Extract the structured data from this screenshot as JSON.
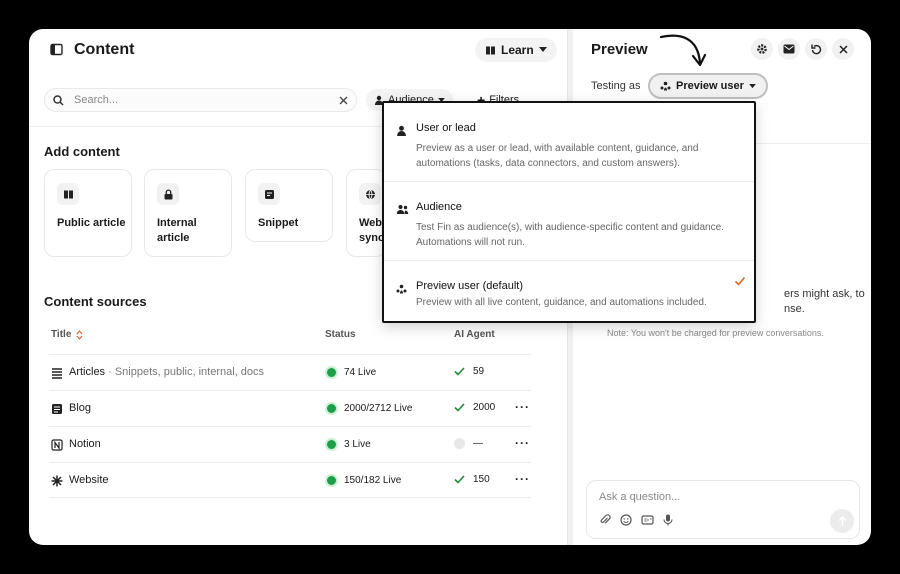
{
  "content_panel": {
    "title": "Content",
    "learn_label": "Learn",
    "search_placeholder": "Search...",
    "audience_label": "Audience",
    "filters_label": "Filters",
    "add_content_title": "Add content",
    "cards": [
      {
        "label": "Public article",
        "icon": "book-icon"
      },
      {
        "label": "Internal article",
        "icon": "lock-icon"
      },
      {
        "label": "Snippet",
        "icon": "note-icon"
      },
      {
        "label": "Web sync",
        "icon": "globe-icon"
      }
    ],
    "sources_title": "Content sources",
    "columns": {
      "title": "Title",
      "status": "Status",
      "agent": "AI Agent"
    },
    "rows": [
      {
        "name": "Articles",
        "sub": " · Snippets, public, internal, docs",
        "status": "74 Live",
        "agent": "59",
        "live": true,
        "enabled": true,
        "more": false
      },
      {
        "name": "Blog",
        "sub": "",
        "status": "2000/2712 Live",
        "agent": "2000",
        "live": true,
        "enabled": true,
        "more": true
      },
      {
        "name": "Notion",
        "sub": "",
        "status": "3 Live",
        "agent": "—",
        "live": true,
        "enabled": false,
        "more": true
      },
      {
        "name": "Website",
        "sub": "",
        "status": "150/182 Live",
        "agent": "150",
        "live": true,
        "enabled": true,
        "more": true
      }
    ]
  },
  "preview_panel": {
    "title": "Preview",
    "testing_label": "Testing as",
    "selected_user": "Preview user",
    "body_line1": "ers might ask, to",
    "body_line2": "nse.",
    "note": "Note: You won't be charged for preview conversations.",
    "ask_placeholder": "Ask a question..."
  },
  "dropdown": {
    "options": [
      {
        "title": "User or lead",
        "desc": "Preview as a user or lead, with available content, guidance, and automations (tasks, data connectors, and custom answers).",
        "selected": false
      },
      {
        "title": "Audience",
        "desc": "Test Fin as audience(s), with audience-specific content and guidance. Automations will not run.",
        "selected": false
      },
      {
        "title": "Preview user (default)",
        "desc": "Preview with all live content, guidance, and automations included.",
        "selected": true
      }
    ]
  },
  "colors": {
    "live_green": "#1e9e47",
    "check_orange": "#e0662a",
    "agent_check": "#1e8a3c"
  }
}
